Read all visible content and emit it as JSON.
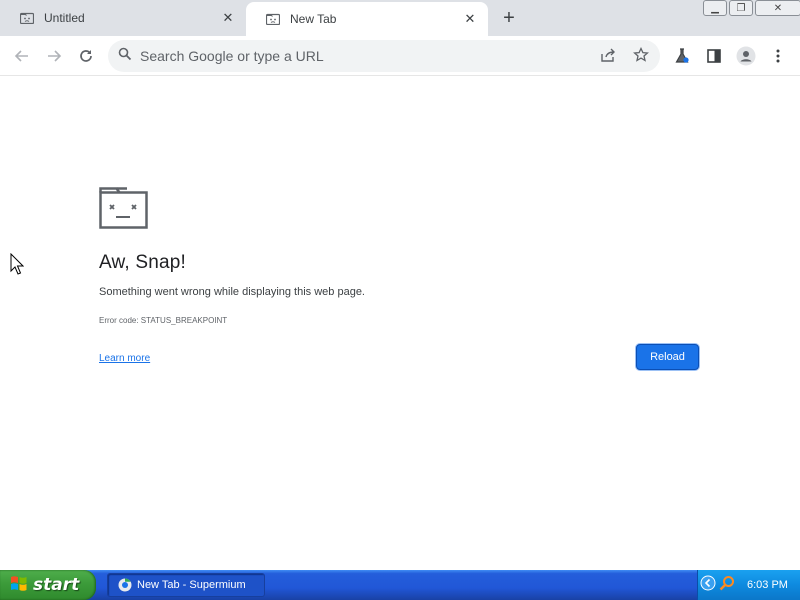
{
  "tabs": [
    {
      "title": "Untitled",
      "icon": "sad-tab-icon",
      "active": false
    },
    {
      "title": "New Tab",
      "icon": "sad-tab-icon",
      "active": true
    }
  ],
  "toolbar": {
    "omnibox_placeholder": "Search Google or type a URL"
  },
  "error_page": {
    "title": "Aw, Snap!",
    "message": "Something went wrong while displaying this web page.",
    "error_code": "Error code: STATUS_BREAKPOINT",
    "learn_more": "Learn more",
    "reload_label": "Reload"
  },
  "taskbar": {
    "start_label": "start",
    "task_label": "New Tab - Supermium",
    "clock": "6:03 PM"
  },
  "colors": {
    "accent": "#1a73e8",
    "taskbar": "#245edb",
    "start": "#3c9b3a"
  }
}
